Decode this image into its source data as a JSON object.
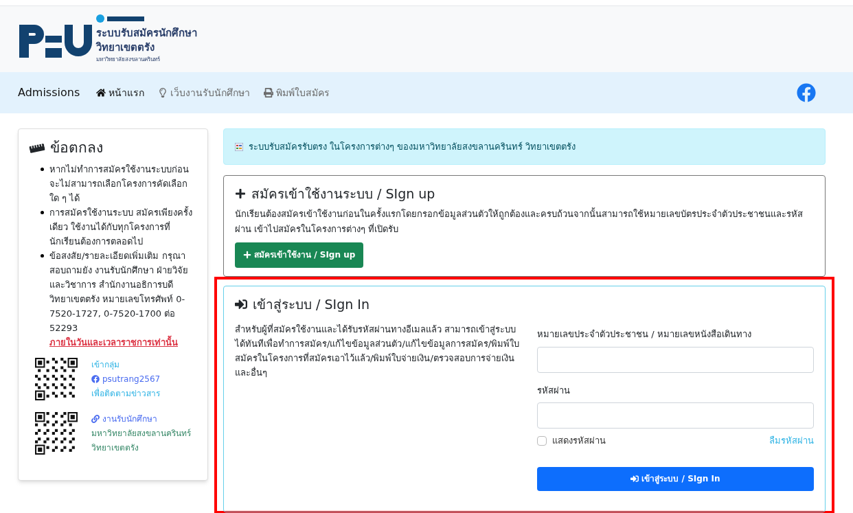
{
  "header": {
    "title_line_1": "ระบบรับสมัครนักศึกษา",
    "title_line_2": "วิทยาเขตตรัง",
    "subtitle": "มหาวิทยาลัยสงขลานครินทร์"
  },
  "nav": {
    "brand": "Admissions",
    "items": [
      {
        "label": "หน้าแรก",
        "kind": "home"
      },
      {
        "label": "เว็บงานรับนักศึกษา",
        "kind": "bulb"
      },
      {
        "label": "พิมพ์ใบสมัคร",
        "kind": "print"
      }
    ]
  },
  "terms": {
    "title": "ข้อตกลง",
    "items": [
      {
        "text": "หากไม่ทำการสมัครใช้งานระบบก่อน จะไม่สามารถเลือกโครงการคัดเลือกใด ๆ ได้"
      },
      {
        "text": "การสมัครใช้งานระบบ สมัครเพียงครั้งเดียว ใช้งานได้กับทุกโครงการที่นักเรียนต้องการตลอดไป"
      },
      {
        "text": "ข้อสงสัย/รายละเอียดเพิ่มเติม กรุณาสอบถามยัง งานรับนักศึกษา  ฝ่ายวิจัยและวิชาการ สำนักงานอธิการบดี วิทยาเขตตรัง  หมายเลขโทรศัพท์ 0-7520-1727, 0-7520-1700 ต่อ 52293 ",
        "warning": "ภายในวันและเวลาราชการเท่านั้น"
      }
    ],
    "contacts": [
      {
        "lines": [
          {
            "text": "เข้ากลุ่ม",
            "kind": "plain"
          },
          {
            "text": "psutrang2567",
            "kind": "facebook"
          },
          {
            "text": "เพื่อติดตามข่าวสาร",
            "kind": "plain"
          }
        ]
      },
      {
        "lines": [
          {
            "text": "งานรับนักศึกษา",
            "kind": "link"
          },
          {
            "text": "มหาวิทยาลัยสงขลานครินทร์",
            "kind": "green"
          },
          {
            "text": "วิทยาเขตตรัง",
            "kind": "green"
          }
        ]
      }
    ]
  },
  "notice": "ระบบรับสมัครรับตรง ในโครงการต่างๆ ของมหาวิทยาลัยสงขลานครินทร์  วิทยาเขตตรัง",
  "signup": {
    "title": "สมัครเข้าใช้งานระบบ / SIgn up",
    "description": "นักเรียนต้องสมัครเข้าใช้งานก่อนในครั้งแรกโดยกรอกข้อมูลส่วนตัวให้ถูกต้องและครบถ้วนจากนั้นสามารถใช้หมายเลขบัตรประจำตัวประชาชนและรหัสผ่าน เข้าไปสมัครในโครงการต่างๆ ที่เปิดรับ",
    "button": "สมัครเข้าใช้งาน / SIgn up"
  },
  "signin": {
    "title": "เข้าสู่ระบบ / SIgn In",
    "description": "สำหรับผู้ที่สมัครใช้งานและได้รับรหัสผ่านทางอีเมลแล้ว  สามารถเข้าสู่ระบบได้ทันทีเพื่อทำการสมัคร/แก้ไขข้อมูลส่วนตัว/แก้ไขข้อมูลการสมัคร/พิมพ์ใบสมัครในโครงการที่สมัครเอาไว้แล้ว/พิมพ์ใบจ่ายเงิน/ตรวจสอบการจ่ายเงินและอื่นๆ",
    "id_label": "หมายเลขประจำตัวประชาชน / หมายเลขหนังสือเดินทาง",
    "password_label": "รหัสผ่าน",
    "show_password": {
      "label": "แสดงรหัสผ่าน",
      "checked": false
    },
    "forgot": "ลืมรหัสผ่าน",
    "button": "เข้าสู่ระบบ / SIgn In",
    "highlighted": true
  }
}
